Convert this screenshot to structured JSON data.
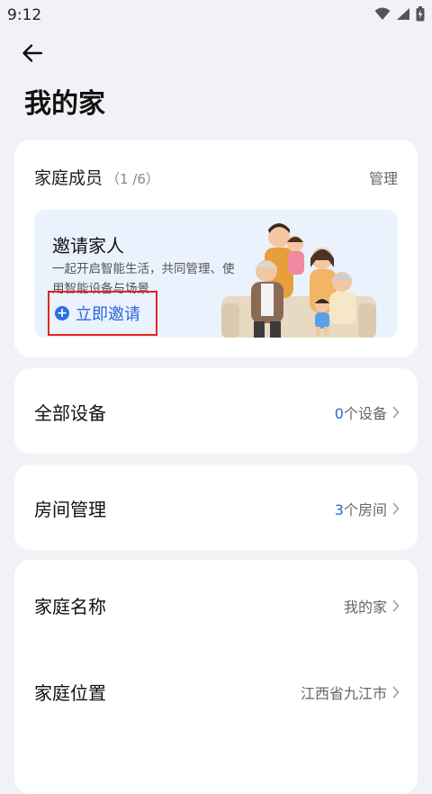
{
  "status_bar": {
    "time": "9:12"
  },
  "header": {
    "title": "我的家"
  },
  "members": {
    "title": "家庭成员",
    "count": "（1 /6）",
    "manage": "管理",
    "invite": {
      "title": "邀请家人",
      "desc": "一起开启智能生活，共同管理、使用智能设备与场景",
      "button": "立即邀请"
    }
  },
  "devices": {
    "title": "全部设备",
    "count": "0",
    "unit": "个设备"
  },
  "rooms": {
    "title": "房间管理",
    "count": "3",
    "unit": "个房间"
  },
  "info": {
    "name_label": "家庭名称",
    "name_value": "我的家",
    "location_label": "家庭位置",
    "location_value": "江西省九江市"
  },
  "colors": {
    "accent": "#2a66d9",
    "highlight": "#e0251f",
    "background": "#f1f2f5"
  }
}
